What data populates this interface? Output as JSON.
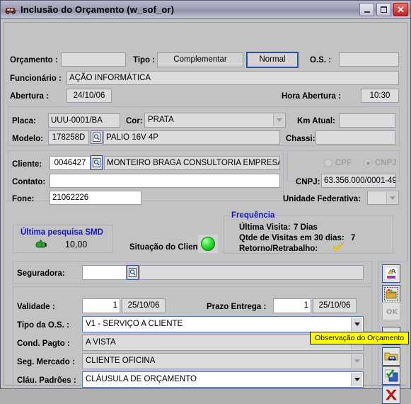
{
  "window": {
    "title": "Inclusão do Orçamento (w_sof_or)",
    "icon": "car-icon",
    "minimize_label": "Minimizar",
    "maximize_label": "Maximizar",
    "close_label": "Fechar"
  },
  "form": {
    "orcamento": {
      "label": "Orçamento :",
      "value": ""
    },
    "tipo": {
      "label": "Tipo :",
      "option_complementar": "Complementar",
      "option_normal": "Normal",
      "selected": "Normal"
    },
    "os": {
      "label": "O.S. :",
      "value": ""
    },
    "funcionario": {
      "label": "Funcionário :",
      "value": "AÇÃO INFORMÁTICA"
    },
    "abertura": {
      "label": "Abertura :",
      "value": "24/10/06"
    },
    "hora_abertura": {
      "label": "Hora Abertura :",
      "value": "10:30"
    },
    "placa": {
      "label": "Placa:",
      "value": "UUU-0001/BA"
    },
    "cor": {
      "label": "Cor:",
      "value": "PRATA"
    },
    "km_atual": {
      "label": "Km Atual:",
      "value": ""
    },
    "modelo": {
      "label": "Modelo:",
      "code": "178258D",
      "value": "PALIO 16V 4P",
      "lookup_icon": "search-icon"
    },
    "chassi": {
      "label": "Chassi:",
      "value": ""
    },
    "cliente": {
      "label": "Cliente:",
      "code": "0046427",
      "value": "MONTEIRO BRAGA CONSULTORIA EMPRESAI",
      "lookup_icon": "search-icon"
    },
    "cpf_radio": {
      "label": "CPF",
      "selected": false
    },
    "cnpj_radio": {
      "label": "CNPJ",
      "selected": true
    },
    "contato": {
      "label": "Contato:",
      "value": ""
    },
    "cnpj": {
      "label": "CNPJ:",
      "value": "63.356.000/0001-49"
    },
    "fone": {
      "label": "Fone:",
      "value": "21062226"
    },
    "unidade_federativa": {
      "label": "Unidade Federativa:",
      "value": ""
    },
    "seguradora": {
      "label": "Seguradora:",
      "code": "",
      "value": "",
      "lookup_icon": "search-icon"
    },
    "validade": {
      "label": "Validade :",
      "qty": "1",
      "date": "25/10/06"
    },
    "prazo_entrega": {
      "label": "Prazo Entrega :",
      "qty": "1",
      "date": "25/10/06"
    },
    "tipo_os": {
      "label": "Tipo da O.S. :",
      "value": "V1 - SERVIÇO A CLIENTE"
    },
    "cond_pagto": {
      "label": "Cond. Pagto :",
      "value": "A VISTA"
    },
    "seg_mercado": {
      "label": "Seg. Mercado :",
      "value": "CLIENTE OFICINA"
    },
    "clau_padroes": {
      "label": "Cláu. Padrões :",
      "value": "CLÁUSULA DE ORÇAMENTO"
    }
  },
  "smd": {
    "title": "Última pesquisa SMD",
    "icon": "thumbs-up-icon",
    "value": "10,00"
  },
  "situacao": {
    "label": "Situação do Cliente:",
    "status_color": "#22dd22",
    "icon": "green-led-icon"
  },
  "frequencia": {
    "title": "Frequência",
    "ultima_visita_label": "Última Visita:",
    "ultima_visita_value": "7 Dias",
    "qtde_visitas_label": "Qtde de Visitas em 30 dias:",
    "qtde_visitas_value": "7",
    "retorno_label": "Retorno/Retrabalho:",
    "retorno_icon": "yellow-check-icon"
  },
  "toolbar": {
    "buttons": [
      {
        "name": "pesquisa-button",
        "icon": "paint-search-icon",
        "enabled": true
      },
      {
        "name": "arquivo-button",
        "icon": "folder-box-icon",
        "enabled": true
      },
      {
        "name": "ok-button",
        "icon": "ok-disabled-icon",
        "enabled": false
      },
      {
        "name": "abrir-button",
        "icon": "open-folder-icon",
        "enabled": true
      },
      {
        "name": "veiculo-button",
        "icon": "car-folder-icon",
        "enabled": true
      },
      {
        "name": "confirmar-button",
        "icon": "green-check-icon",
        "enabled": true
      },
      {
        "name": "cancelar-button",
        "icon": "red-x-icon",
        "enabled": true
      }
    ]
  },
  "tooltip": {
    "text": "Observação do Orçamento"
  }
}
